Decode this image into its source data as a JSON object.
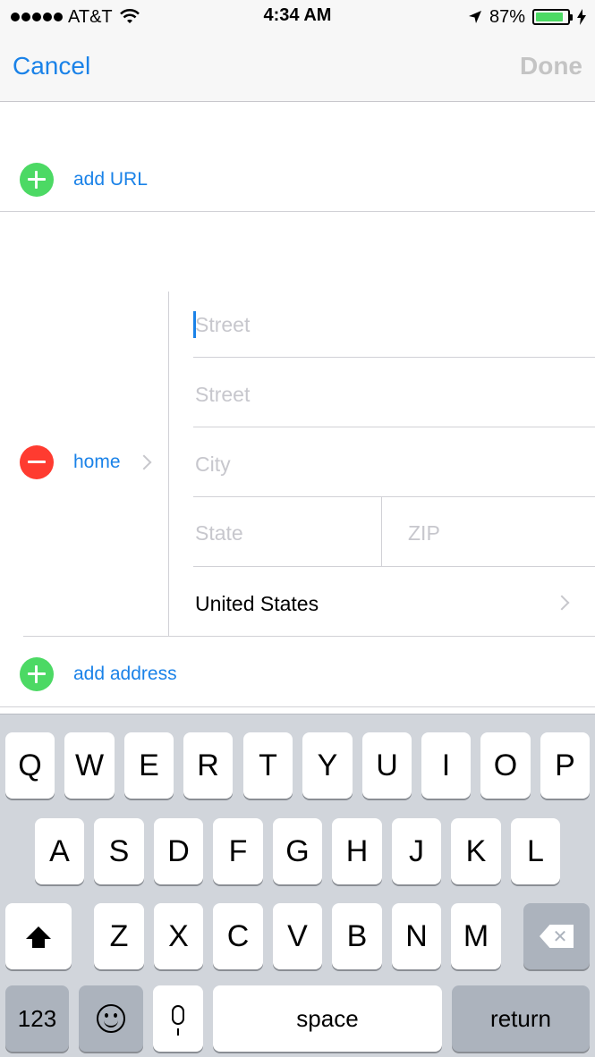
{
  "status_bar": {
    "carrier": "AT&T",
    "time": "4:34 AM",
    "battery_percent": "87%",
    "battery_level": 0.87
  },
  "nav": {
    "cancel_label": "Cancel",
    "done_label": "Done"
  },
  "add_url_label": "add URL",
  "address": {
    "type_label": "home",
    "street1_placeholder": "Street",
    "street2_placeholder": "Street",
    "city_placeholder": "City",
    "state_placeholder": "State",
    "zip_placeholder": "ZIP",
    "country": "United States"
  },
  "add_address_label": "add address",
  "keyboard": {
    "row1": [
      "Q",
      "W",
      "E",
      "R",
      "T",
      "Y",
      "U",
      "I",
      "O",
      "P"
    ],
    "row2": [
      "A",
      "S",
      "D",
      "F",
      "G",
      "H",
      "J",
      "K",
      "L"
    ],
    "row3": [
      "Z",
      "X",
      "C",
      "V",
      "B",
      "N",
      "M"
    ],
    "numbers_label": "123",
    "space_label": "space",
    "return_label": "return"
  },
  "colors": {
    "accent": "#1a82e8",
    "add_green": "#4cd964",
    "delete_red": "#ff3b30"
  }
}
